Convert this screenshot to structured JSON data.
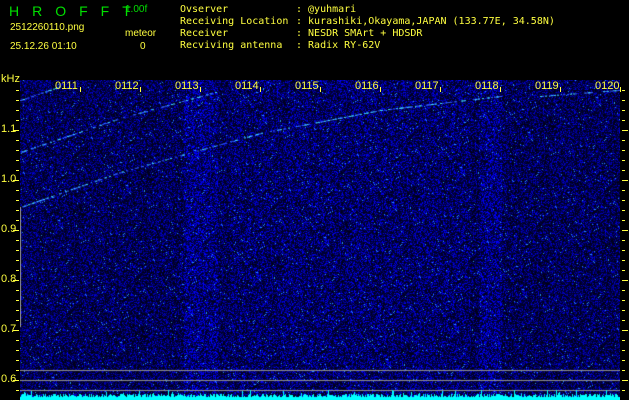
{
  "header": {
    "title": "HROFFT",
    "version": "1.00f",
    "filename": "2512260110.png",
    "datetime": "25.12.26 01:10",
    "meteor_label": "meteor",
    "meteor_count": "0"
  },
  "info": [
    {
      "label": "Ovserver",
      "value": ": @yuhmari"
    },
    {
      "label": "Receiving Location",
      "value": ": kurashiki,Okayama,JAPAN (133.77E, 34.58N)"
    },
    {
      "label": "Receiver",
      "value": ": NESDR SMArt + HDSDR"
    },
    {
      "label": "Recviving antenna",
      "value": ": Radix RY-62V"
    }
  ],
  "axis": {
    "y_unit": "kHz",
    "y_ticks": [
      "1.1",
      "1.0",
      "0.9",
      "0.8",
      "0.7",
      "0.6"
    ],
    "y_range_khz": [
      0.56,
      1.2
    ],
    "time_ticks": [
      "0111",
      "0112",
      "0113",
      "0114",
      "0115",
      "0116",
      "0117",
      "0118",
      "0119",
      "0120"
    ]
  },
  "colors": {
    "background": "#000000",
    "text_yellow": "#ffff40",
    "title_green": "#00e000",
    "noise_blue": "#1020c0",
    "histogram_cyan": "#00ffff"
  }
}
